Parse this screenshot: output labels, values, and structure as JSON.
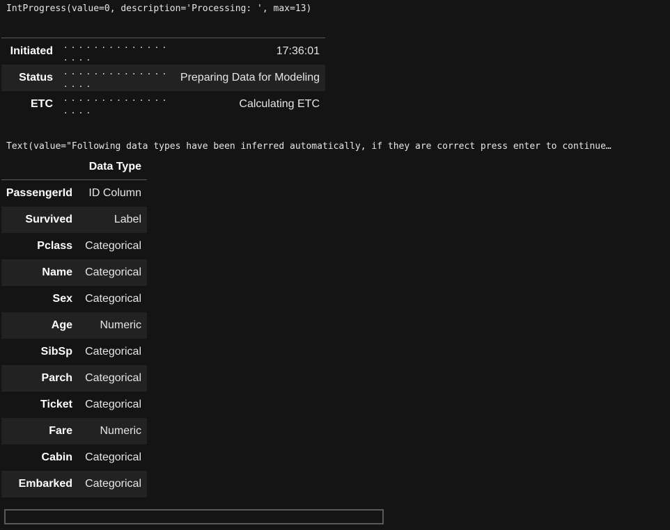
{
  "widget_repr": "IntProgress(value=0, description='Processing: ', max=13)",
  "status_table": {
    "rows": [
      {
        "label": "Initiated",
        "dots": ". . . . . . . . . . . . . . . . . .",
        "value": "17:36:01"
      },
      {
        "label": "Status",
        "dots": ". . . . . . . . . . . . . . . . . .",
        "value": "Preparing Data for Modeling"
      },
      {
        "label": "ETC",
        "dots": ". . . . . . . . . . . . . . . . . .",
        "value": "Calculating ETC"
      }
    ]
  },
  "text_repr": "Text(value=\"Following data types have been inferred automatically, if they are correct press enter to continue…",
  "dtype_table": {
    "header": "Data Type",
    "rows": [
      {
        "name": "PassengerId",
        "type": "ID Column"
      },
      {
        "name": "Survived",
        "type": "Label"
      },
      {
        "name": "Pclass",
        "type": "Categorical"
      },
      {
        "name": "Name",
        "type": "Categorical"
      },
      {
        "name": "Sex",
        "type": "Categorical"
      },
      {
        "name": "Age",
        "type": "Numeric"
      },
      {
        "name": "SibSp",
        "type": "Categorical"
      },
      {
        "name": "Parch",
        "type": "Categorical"
      },
      {
        "name": "Ticket",
        "type": "Categorical"
      },
      {
        "name": "Fare",
        "type": "Numeric"
      },
      {
        "name": "Cabin",
        "type": "Categorical"
      },
      {
        "name": "Embarked",
        "type": "Categorical"
      }
    ]
  },
  "input": {
    "value": ""
  },
  "colors": {
    "background": "#141414",
    "row_alt": "#222222",
    "border": "#5a5a5a",
    "text": "#e6e6e6"
  }
}
